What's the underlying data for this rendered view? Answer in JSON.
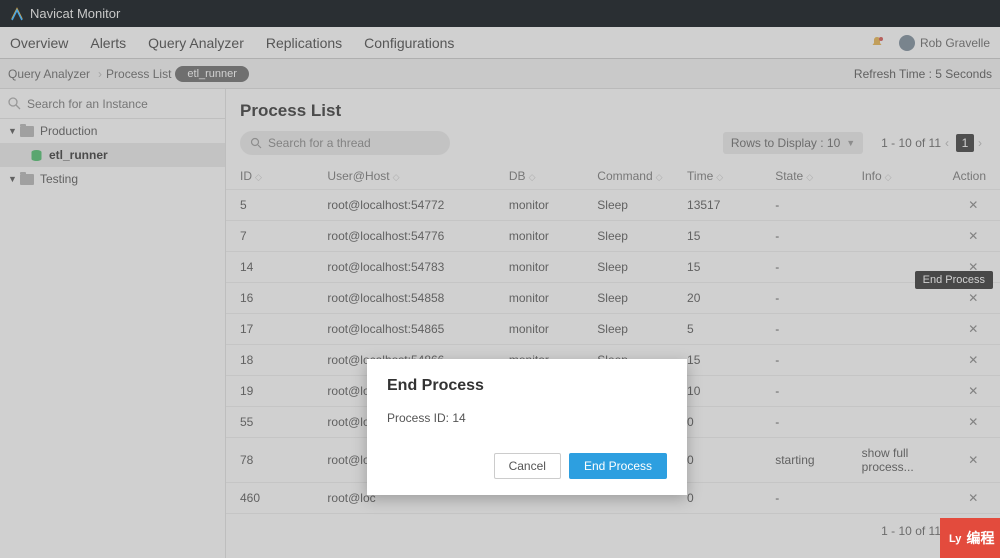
{
  "app": {
    "title": "Navicat Monitor"
  },
  "nav": {
    "items": [
      "Overview",
      "Alerts",
      "Query Analyzer",
      "Replications",
      "Configurations"
    ],
    "user": "Rob Gravelle"
  },
  "breadcrumb": {
    "items": [
      "Query Analyzer",
      "Process List"
    ],
    "pill": "etl_runner",
    "refresh": "Refresh Time : 5 Seconds"
  },
  "sidebar": {
    "search_placeholder": "Search for an Instance",
    "nodes": [
      {
        "label": "Production",
        "children": [
          {
            "label": "etl_runner",
            "selected": true
          }
        ]
      },
      {
        "label": "Testing",
        "children": []
      }
    ]
  },
  "content": {
    "title": "Process List",
    "thread_search_placeholder": "Search for a thread",
    "rows_to_display_label": "Rows to Display : 10",
    "page_info": "1 - 10 of 11",
    "page_current": "1",
    "columns": [
      "ID",
      "User@Host",
      "DB",
      "Command",
      "Time",
      "State",
      "Info",
      "Action"
    ],
    "rows": [
      {
        "id": "5",
        "user_host": "root@localhost:54772",
        "db": "monitor",
        "command": "Sleep",
        "time": "13517",
        "state": "-",
        "info": ""
      },
      {
        "id": "7",
        "user_host": "root@localhost:54776",
        "db": "monitor",
        "command": "Sleep",
        "time": "15",
        "state": "-",
        "info": ""
      },
      {
        "id": "14",
        "user_host": "root@localhost:54783",
        "db": "monitor",
        "command": "Sleep",
        "time": "15",
        "state": "-",
        "info": ""
      },
      {
        "id": "16",
        "user_host": "root@localhost:54858",
        "db": "monitor",
        "command": "Sleep",
        "time": "20",
        "state": "-",
        "info": ""
      },
      {
        "id": "17",
        "user_host": "root@localhost:54865",
        "db": "monitor",
        "command": "Sleep",
        "time": "5",
        "state": "-",
        "info": ""
      },
      {
        "id": "18",
        "user_host": "root@localhost:54866",
        "db": "monitor",
        "command": "Sleep",
        "time": "15",
        "state": "-",
        "info": ""
      },
      {
        "id": "19",
        "user_host": "root@loc",
        "db": "",
        "command": "",
        "time": "10",
        "state": "-",
        "info": ""
      },
      {
        "id": "55",
        "user_host": "root@loc",
        "db": "",
        "command": "",
        "time": "0",
        "state": "-",
        "info": ""
      },
      {
        "id": "78",
        "user_host": "root@loc",
        "db": "",
        "command": "",
        "time": "0",
        "state": "starting",
        "info": "show full process..."
      },
      {
        "id": "460",
        "user_host": "root@loc",
        "db": "",
        "command": "",
        "time": "0",
        "state": "-",
        "info": ""
      }
    ]
  },
  "tooltip": {
    "end_process": "End Process"
  },
  "modal": {
    "title": "End Process",
    "body": "Process ID: 14",
    "cancel": "Cancel",
    "confirm": "End Process"
  },
  "watermark": {
    "text": "编程"
  }
}
